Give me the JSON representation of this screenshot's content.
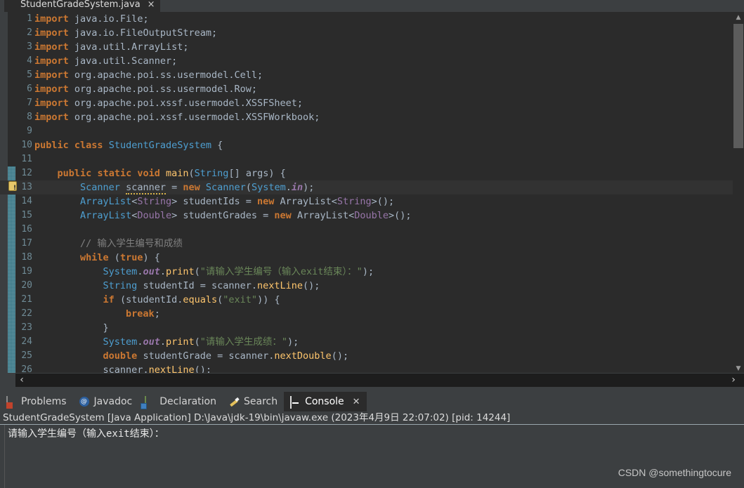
{
  "editor_tab": {
    "title": "StudentGradeSystem.java",
    "icon": "java-file-icon",
    "close": "×"
  },
  "code": {
    "first_line_number": 1,
    "highlighted_line": 13,
    "warning_line": 13,
    "fold_range_start_line": 12,
    "lines": [
      {
        "n": 1,
        "tokens": [
          {
            "t": "import",
            "c": "kw"
          },
          {
            "t": " java.io.File;",
            "c": "pln"
          }
        ]
      },
      {
        "n": 2,
        "tokens": [
          {
            "t": "import",
            "c": "kw"
          },
          {
            "t": " java.io.FileOutputStream;",
            "c": "pln"
          }
        ]
      },
      {
        "n": 3,
        "tokens": [
          {
            "t": "import",
            "c": "kw"
          },
          {
            "t": " java.util.ArrayList;",
            "c": "pln"
          }
        ]
      },
      {
        "n": 4,
        "tokens": [
          {
            "t": "import",
            "c": "kw"
          },
          {
            "t": " java.util.Scanner;",
            "c": "pln"
          }
        ]
      },
      {
        "n": 5,
        "tokens": [
          {
            "t": "import",
            "c": "kw"
          },
          {
            "t": " org.apache.poi.ss.usermodel.Cell;",
            "c": "pln"
          }
        ]
      },
      {
        "n": 6,
        "tokens": [
          {
            "t": "import",
            "c": "kw"
          },
          {
            "t": " org.apache.poi.ss.usermodel.Row;",
            "c": "pln"
          }
        ]
      },
      {
        "n": 7,
        "tokens": [
          {
            "t": "import",
            "c": "kw"
          },
          {
            "t": " org.apache.poi.xssf.usermodel.XSSFSheet;",
            "c": "pln"
          }
        ]
      },
      {
        "n": 8,
        "tokens": [
          {
            "t": "import",
            "c": "kw"
          },
          {
            "t": " org.apache.poi.xssf.usermodel.XSSFWorkbook;",
            "c": "pln"
          }
        ]
      },
      {
        "n": 9,
        "tokens": []
      },
      {
        "n": 10,
        "tokens": [
          {
            "t": "public",
            "c": "kw"
          },
          {
            "t": " ",
            "c": "pln"
          },
          {
            "t": "class",
            "c": "kw"
          },
          {
            "t": " ",
            "c": "pln"
          },
          {
            "t": "StudentGradeSystem",
            "c": "typ"
          },
          {
            "t": " {",
            "c": "pln"
          }
        ]
      },
      {
        "n": 11,
        "tokens": []
      },
      {
        "n": 12,
        "tokens": [
          {
            "t": "    ",
            "c": "pln"
          },
          {
            "t": "public",
            "c": "kw"
          },
          {
            "t": " ",
            "c": "pln"
          },
          {
            "t": "static",
            "c": "kw"
          },
          {
            "t": " ",
            "c": "pln"
          },
          {
            "t": "void",
            "c": "kw"
          },
          {
            "t": " ",
            "c": "pln"
          },
          {
            "t": "main",
            "c": "fn"
          },
          {
            "t": "(",
            "c": "pln"
          },
          {
            "t": "String",
            "c": "typ"
          },
          {
            "t": "[] args) {",
            "c": "pln"
          }
        ]
      },
      {
        "n": 13,
        "tokens": [
          {
            "t": "        ",
            "c": "pln"
          },
          {
            "t": "Scanner",
            "c": "typ"
          },
          {
            "t": " ",
            "c": "pln"
          },
          {
            "t": "scanner",
            "c": "pln warn-underline"
          },
          {
            "t": " = ",
            "c": "pln"
          },
          {
            "t": "new",
            "c": "kw"
          },
          {
            "t": " ",
            "c": "pln"
          },
          {
            "t": "Scanner",
            "c": "typ"
          },
          {
            "t": "(",
            "c": "pln"
          },
          {
            "t": "System",
            "c": "typ"
          },
          {
            "t": ".",
            "c": "pln"
          },
          {
            "t": "in",
            "c": "fld"
          },
          {
            "t": ");",
            "c": "pln"
          }
        ]
      },
      {
        "n": 14,
        "tokens": [
          {
            "t": "        ",
            "c": "pln"
          },
          {
            "t": "ArrayList",
            "c": "typ"
          },
          {
            "t": "<",
            "c": "pln"
          },
          {
            "t": "String",
            "c": "gen"
          },
          {
            "t": "> studentIds = ",
            "c": "pln"
          },
          {
            "t": "new",
            "c": "kw"
          },
          {
            "t": " ArrayList<",
            "c": "pln"
          },
          {
            "t": "String",
            "c": "gen"
          },
          {
            "t": ">();",
            "c": "pln"
          }
        ]
      },
      {
        "n": 15,
        "tokens": [
          {
            "t": "        ",
            "c": "pln"
          },
          {
            "t": "ArrayList",
            "c": "typ"
          },
          {
            "t": "<",
            "c": "pln"
          },
          {
            "t": "Double",
            "c": "gen"
          },
          {
            "t": "> studentGrades = ",
            "c": "pln"
          },
          {
            "t": "new",
            "c": "kw"
          },
          {
            "t": " ArrayList<",
            "c": "pln"
          },
          {
            "t": "Double",
            "c": "gen"
          },
          {
            "t": ">();",
            "c": "pln"
          }
        ]
      },
      {
        "n": 16,
        "tokens": []
      },
      {
        "n": 17,
        "tokens": [
          {
            "t": "        ",
            "c": "pln"
          },
          {
            "t": "// 输入学生编号和成绩",
            "c": "cmt"
          }
        ]
      },
      {
        "n": 18,
        "tokens": [
          {
            "t": "        ",
            "c": "pln"
          },
          {
            "t": "while",
            "c": "kw"
          },
          {
            "t": " (",
            "c": "pln"
          },
          {
            "t": "true",
            "c": "kw"
          },
          {
            "t": ") {",
            "c": "pln"
          }
        ]
      },
      {
        "n": 19,
        "tokens": [
          {
            "t": "            ",
            "c": "pln"
          },
          {
            "t": "System",
            "c": "typ"
          },
          {
            "t": ".",
            "c": "pln"
          },
          {
            "t": "out",
            "c": "fld"
          },
          {
            "t": ".",
            "c": "pln"
          },
          {
            "t": "print",
            "c": "fn"
          },
          {
            "t": "(",
            "c": "pln"
          },
          {
            "t": "\"请输入学生编号（输入exit结束）：\"",
            "c": "str"
          },
          {
            "t": ");",
            "c": "pln"
          }
        ]
      },
      {
        "n": 20,
        "tokens": [
          {
            "t": "            ",
            "c": "pln"
          },
          {
            "t": "String",
            "c": "typ"
          },
          {
            "t": " studentId = scanner.",
            "c": "pln"
          },
          {
            "t": "nextLine",
            "c": "fn"
          },
          {
            "t": "();",
            "c": "pln"
          }
        ]
      },
      {
        "n": 21,
        "tokens": [
          {
            "t": "            ",
            "c": "pln"
          },
          {
            "t": "if",
            "c": "kw"
          },
          {
            "t": " (studentId.",
            "c": "pln"
          },
          {
            "t": "equals",
            "c": "fn"
          },
          {
            "t": "(",
            "c": "pln"
          },
          {
            "t": "\"exit\"",
            "c": "str"
          },
          {
            "t": ")) {",
            "c": "pln"
          }
        ]
      },
      {
        "n": 22,
        "tokens": [
          {
            "t": "                ",
            "c": "pln"
          },
          {
            "t": "break",
            "c": "kw"
          },
          {
            "t": ";",
            "c": "pln"
          }
        ]
      },
      {
        "n": 23,
        "tokens": [
          {
            "t": "            }",
            "c": "pln"
          }
        ]
      },
      {
        "n": 24,
        "tokens": [
          {
            "t": "            ",
            "c": "pln"
          },
          {
            "t": "System",
            "c": "typ"
          },
          {
            "t": ".",
            "c": "pln"
          },
          {
            "t": "out",
            "c": "fld"
          },
          {
            "t": ".",
            "c": "pln"
          },
          {
            "t": "print",
            "c": "fn"
          },
          {
            "t": "(",
            "c": "pln"
          },
          {
            "t": "\"请输入学生成绩：\"",
            "c": "str"
          },
          {
            "t": ");",
            "c": "pln"
          }
        ]
      },
      {
        "n": 25,
        "tokens": [
          {
            "t": "            ",
            "c": "pln"
          },
          {
            "t": "double",
            "c": "kw"
          },
          {
            "t": " studentGrade = scanner.",
            "c": "pln"
          },
          {
            "t": "nextDouble",
            "c": "fn"
          },
          {
            "t": "();",
            "c": "pln"
          }
        ]
      },
      {
        "n": 26,
        "tokens": [
          {
            "t": "            ",
            "c": "pln"
          },
          {
            "t": "scanner.",
            "c": "pln"
          },
          {
            "t": "nextLine",
            "c": "fn"
          },
          {
            "t": "();",
            "c": "pln"
          }
        ]
      }
    ]
  },
  "editor_scrollbars": {
    "up_arrow": "▲",
    "down_arrow": "▼",
    "left_arrow": "‹",
    "right_arrow": "›"
  },
  "view_tabs": [
    {
      "label": "Problems",
      "icon": "problems-icon",
      "active": false,
      "closable": false
    },
    {
      "label": "Javadoc",
      "icon": "javadoc-icon",
      "active": false,
      "closable": false
    },
    {
      "label": "Declaration",
      "icon": "declaration-icon",
      "active": false,
      "closable": false
    },
    {
      "label": "Search",
      "icon": "search-icon",
      "active": false,
      "closable": false
    },
    {
      "label": "Console",
      "icon": "console-icon",
      "active": true,
      "closable": true,
      "close": "✕"
    }
  ],
  "console": {
    "status_line": "StudentGradeSystem [Java Application] D:\\Java\\jdk-19\\bin\\javaw.exe  (2023年4月9日 22:07:02) [pid: 14244]",
    "output_lines": [
      "请输入学生编号（输入exit结束）："
    ]
  },
  "watermark": "CSDN @somethingtocure",
  "colors": {
    "editor_bg": "#2b2b2b",
    "chrome_bg": "#3c3f41",
    "keyword": "#cc7832",
    "type": "#4e9fd1",
    "string": "#6a8759",
    "comment": "#808080",
    "method": "#ffc66d",
    "generic": "#9876aa",
    "line_number": "#6f8b96",
    "fold_band": "#2b6e7e"
  }
}
